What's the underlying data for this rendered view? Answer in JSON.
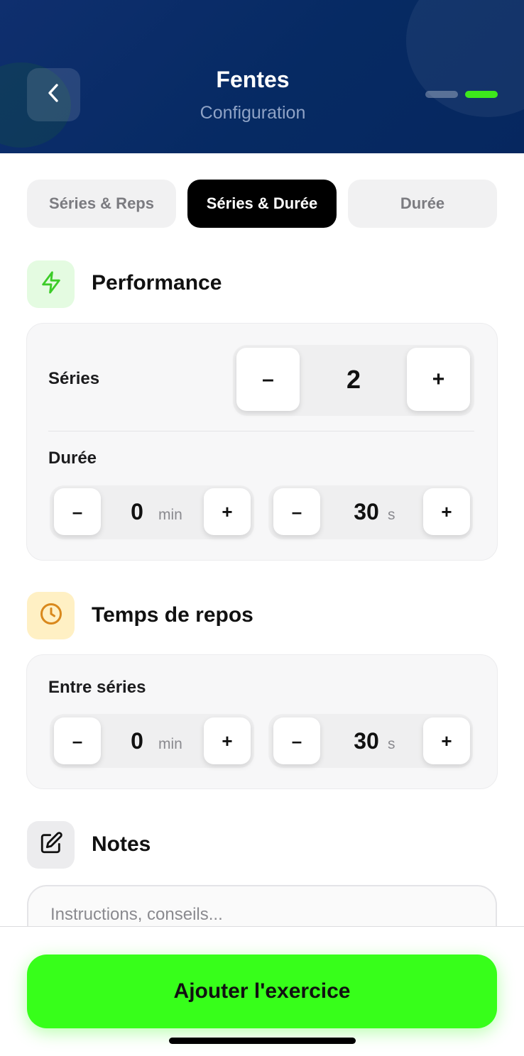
{
  "header": {
    "title": "Fentes",
    "subtitle": "Configuration",
    "back_icon": "chevron-left-icon",
    "steps_total": 2,
    "step_current": 2
  },
  "tabs": [
    {
      "label": "Séries & Reps",
      "selected": false
    },
    {
      "label": "Séries & Durée",
      "selected": true
    },
    {
      "label": "Durée",
      "selected": false
    }
  ],
  "performance": {
    "title": "Performance",
    "icon": "lightning-bolt-icon",
    "icon_color": "#3ccc28",
    "sets": {
      "label": "Séries",
      "value": "2",
      "minus": "–",
      "plus": "+"
    },
    "duration": {
      "label": "Durée",
      "minutes": {
        "value": "0",
        "unit": "min",
        "minus": "–",
        "plus": "+"
      },
      "seconds": {
        "value": "30",
        "unit": "s",
        "minus": "–",
        "plus": "+"
      }
    }
  },
  "rest": {
    "title": "Temps de repos",
    "icon": "clock-icon",
    "icon_color": "#d9881c",
    "between_sets": {
      "label": "Entre séries",
      "minutes": {
        "value": "0",
        "unit": "min",
        "minus": "–",
        "plus": "+"
      },
      "seconds": {
        "value": "30",
        "unit": "s",
        "minus": "–",
        "plus": "+"
      }
    }
  },
  "notes": {
    "title": "Notes",
    "icon": "edit-icon",
    "placeholder": "Instructions, conseils..."
  },
  "cta": {
    "label": "Ajouter l'exercice",
    "color": "#37ff1a"
  },
  "colors": {
    "header_bg": "#062a63",
    "accent_green": "#3de81c"
  }
}
